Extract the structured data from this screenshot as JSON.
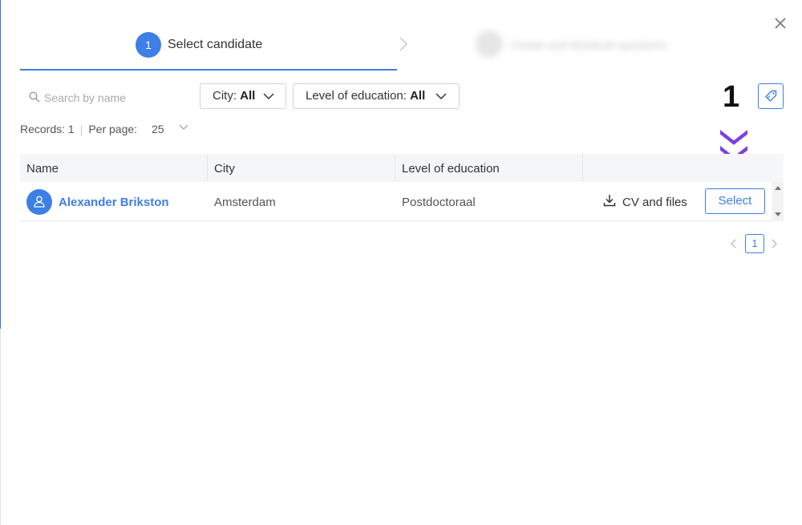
{
  "dialog": {
    "close_icon": "close-icon"
  },
  "steps": [
    {
      "number": "1",
      "label": "Select candidate",
      "active": true
    },
    {
      "number": "2",
      "label": "Create and distribute questions",
      "active": false
    }
  ],
  "search": {
    "placeholder": "Search by name",
    "value": ""
  },
  "filters": {
    "city": {
      "label": "City: ",
      "value": "All"
    },
    "education": {
      "label": "Level of education: ",
      "value": "All"
    }
  },
  "annotation": {
    "number": "1",
    "color": "#7b3fe4"
  },
  "records": {
    "label": "Records: 1",
    "per_page_label": "Per page:",
    "per_page_value": "25"
  },
  "table": {
    "headers": [
      "Name",
      "City",
      "Level of education",
      ""
    ],
    "rows": [
      {
        "name": "Alexander Brikston",
        "city": "Amsterdam",
        "education": "Postdoctoraal",
        "files_label": "CV and files",
        "action_label": "Select"
      }
    ]
  },
  "pagination": {
    "current": "1"
  },
  "colors": {
    "accent": "#3d7fe6",
    "annotation": "#7b3fe4"
  }
}
